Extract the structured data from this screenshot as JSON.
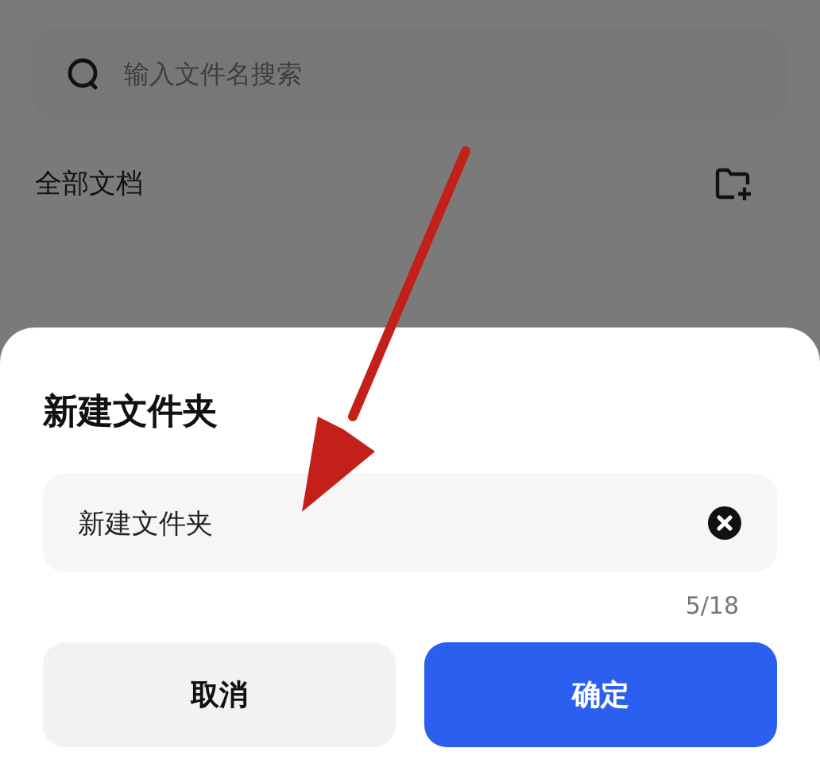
{
  "search": {
    "placeholder": "输入文件名搜索"
  },
  "section": {
    "title": "全部文档"
  },
  "dialog": {
    "title": "新建文件夹",
    "field": {
      "value": "新建文件夹"
    },
    "counter": "5/18",
    "buttons": [
      {
        "label": "取消",
        "kind": "secondary"
      },
      {
        "label": "确定",
        "kind": "primary"
      }
    ]
  }
}
